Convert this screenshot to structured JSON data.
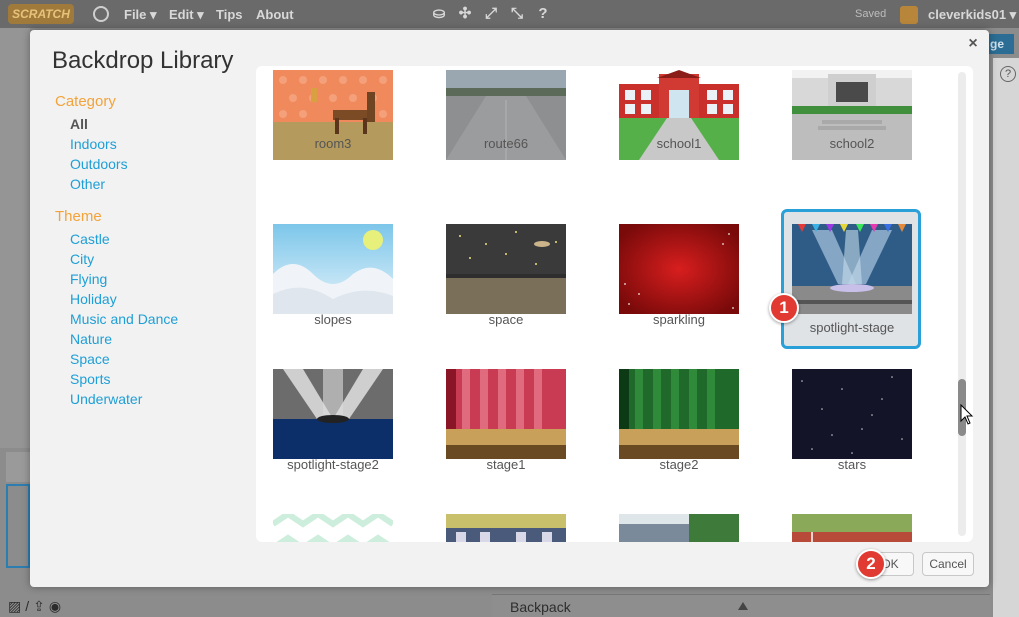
{
  "menubar": {
    "logo": "SCRATCH",
    "items": [
      "File ▾",
      "Edit ▾",
      "Tips",
      "About"
    ],
    "saved": "Saved",
    "username": "cleverkids01 ▾"
  },
  "background": {
    "stage_button": "ge",
    "help": "?",
    "backpack": "Backpack"
  },
  "modal": {
    "title": "Backdrop Library",
    "close": "×",
    "category_heading": "Category",
    "categories": [
      "All",
      "Indoors",
      "Outdoors",
      "Other"
    ],
    "theme_heading": "Theme",
    "themes": [
      "Castle",
      "City",
      "Flying",
      "Holiday",
      "Music and Dance",
      "Nature",
      "Space",
      "Sports",
      "Underwater"
    ],
    "backdrops": [
      {
        "name": "room3"
      },
      {
        "name": "route66"
      },
      {
        "name": "school1"
      },
      {
        "name": "school2"
      },
      {
        "name": "slopes"
      },
      {
        "name": "space"
      },
      {
        "name": "sparkling"
      },
      {
        "name": "spotlight-stage",
        "selected": true
      },
      {
        "name": "spotlight-stage2"
      },
      {
        "name": "stage1"
      },
      {
        "name": "stage2"
      },
      {
        "name": "stars"
      }
    ],
    "ok_label": "OK",
    "cancel_label": "Cancel"
  },
  "annotations": {
    "step1": "1",
    "step2": "2"
  },
  "colors": {
    "accent": "#2aa0d8",
    "category": "#f3a33a",
    "link": "#1e9fd6",
    "badge": "#e03a32"
  }
}
